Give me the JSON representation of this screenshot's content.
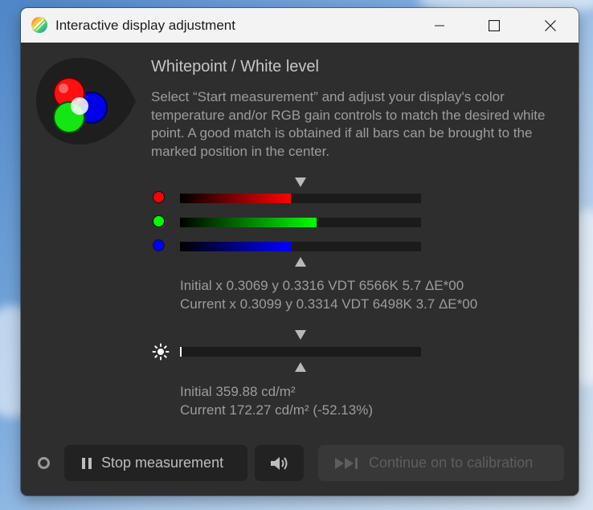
{
  "window": {
    "title": "Interactive display adjustment"
  },
  "heading": "Whitepoint / White level",
  "description": "Select “Start measurement” and adjust your display's color temperature and/or RGB gain controls to match the desired white point. A good match is obtained if all bars can be brought to the marked position in the center.",
  "rgb_bars": [
    {
      "channel": "red",
      "level": 0.46,
      "color": "#ff0000"
    },
    {
      "channel": "green",
      "level": 0.565,
      "color": "#00ff00"
    },
    {
      "channel": "blue",
      "level": 0.46,
      "color": "#0000ff"
    }
  ],
  "whitepoint": {
    "initial": "Initial x 0.3069 y 0.3316 VDT 6566K 5.7 ΔE*00",
    "current": "Current x 0.3099 y 0.3314 VDT 6498K 3.7 ΔE*00"
  },
  "luminance_bar": {
    "level": 0.005
  },
  "luminance": {
    "initial": "Initial 359.88 cd/m²",
    "current": "Current 172.27 cd/m² (-52.13%)"
  },
  "buttons": {
    "stop": "Stop measurement",
    "continue": "Continue on to calibration"
  },
  "icons": {
    "app": "displaycal-icon",
    "minimize": "minimize-icon",
    "maximize": "maximize-icon",
    "close": "close-icon",
    "brightness": "sun-icon",
    "pause": "pause-icon",
    "sound": "speaker-icon",
    "skip": "skip-forward-icon"
  }
}
